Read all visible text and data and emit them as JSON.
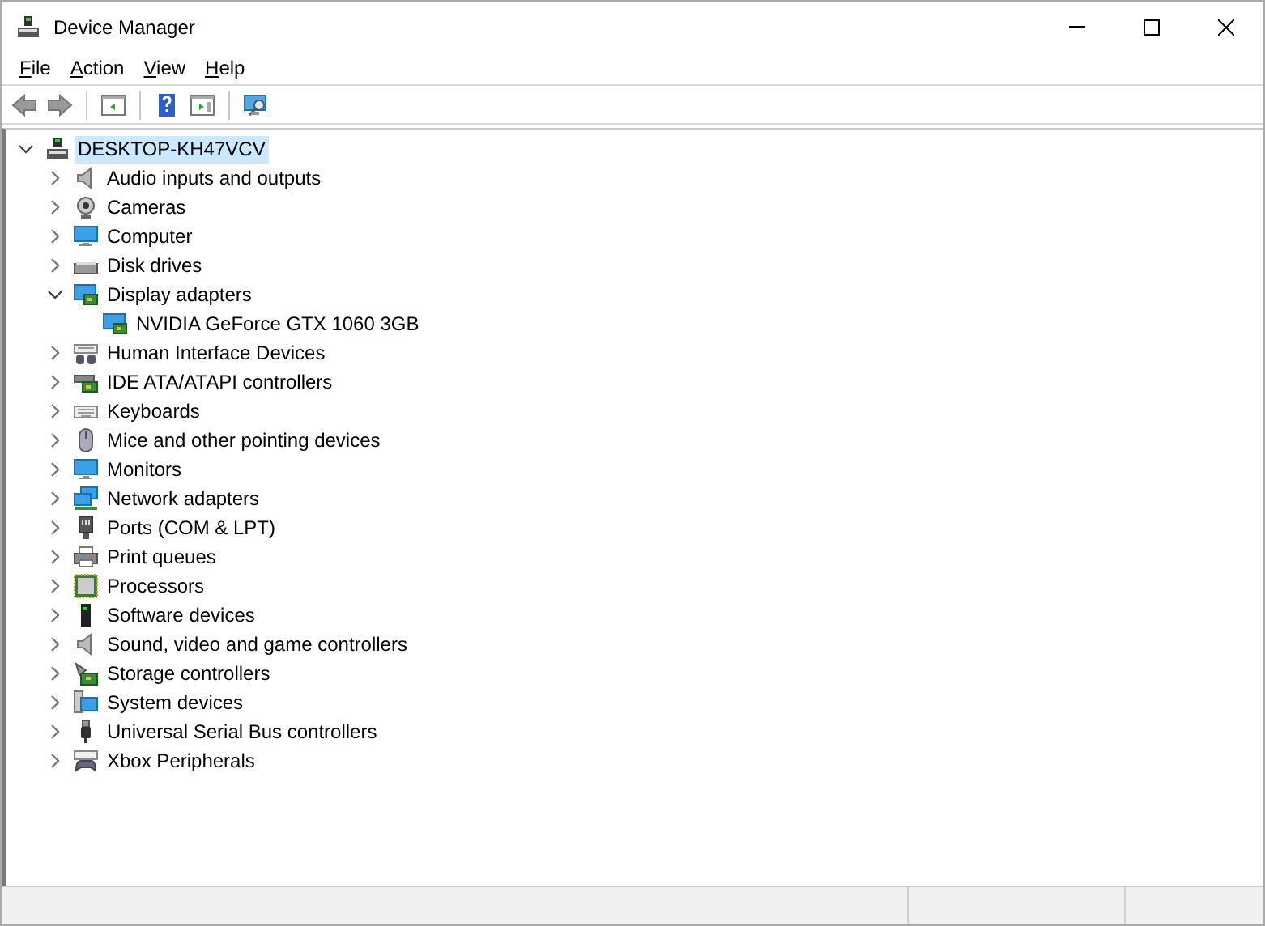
{
  "window": {
    "title": "Device Manager"
  },
  "menu": [
    "File",
    "Action",
    "View",
    "Help"
  ],
  "tree": {
    "label": "DESKTOP-KH47VCV",
    "selected": true,
    "expanded": true,
    "children": [
      {
        "label": "Audio inputs and outputs",
        "expanded": false
      },
      {
        "label": "Cameras",
        "expanded": false
      },
      {
        "label": "Computer",
        "expanded": false
      },
      {
        "label": "Disk drives",
        "expanded": false
      },
      {
        "label": "Display adapters",
        "expanded": true,
        "children": [
          {
            "label": "NVIDIA GeForce GTX 1060 3GB"
          }
        ]
      },
      {
        "label": "Human Interface Devices",
        "expanded": false
      },
      {
        "label": "IDE ATA/ATAPI controllers",
        "expanded": false
      },
      {
        "label": "Keyboards",
        "expanded": false
      },
      {
        "label": "Mice and other pointing devices",
        "expanded": false
      },
      {
        "label": "Monitors",
        "expanded": false
      },
      {
        "label": "Network adapters",
        "expanded": false
      },
      {
        "label": "Ports (COM & LPT)",
        "expanded": false
      },
      {
        "label": "Print queues",
        "expanded": false
      },
      {
        "label": "Processors",
        "expanded": false
      },
      {
        "label": "Software devices",
        "expanded": false
      },
      {
        "label": "Sound, video and game controllers",
        "expanded": false
      },
      {
        "label": "Storage controllers",
        "expanded": false
      },
      {
        "label": "System devices",
        "expanded": false
      },
      {
        "label": "Universal Serial Bus controllers",
        "expanded": false
      },
      {
        "label": "Xbox Peripherals",
        "expanded": false
      }
    ]
  }
}
